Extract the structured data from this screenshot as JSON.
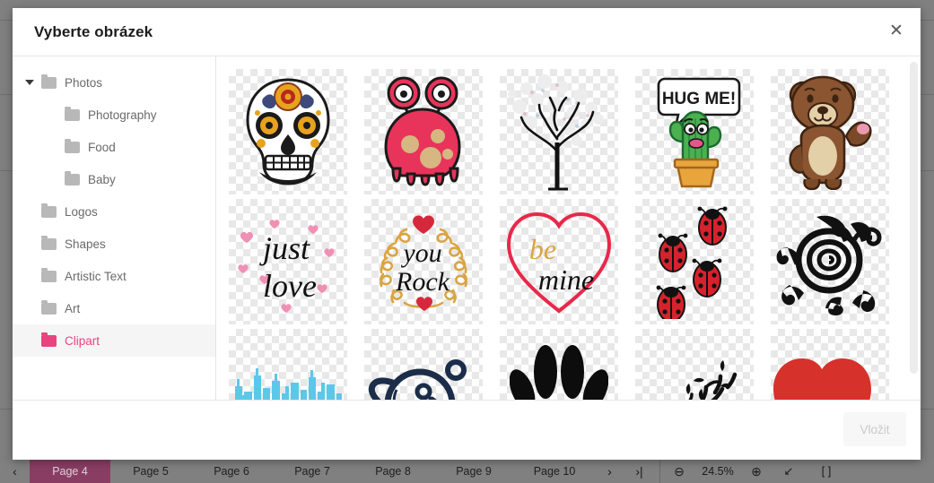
{
  "app": {
    "toolbar": {
      "undo_icon": "undo-arrow-icon",
      "redo_icon": "redo-arrow-icon"
    },
    "status_bar": {
      "prev_page_label": "‹",
      "next_page_label": "›",
      "last_page_label": "›|",
      "pages": [
        {
          "label": "Page 4",
          "active": true
        },
        {
          "label": "Page 5",
          "active": false
        },
        {
          "label": "Page 6",
          "active": false
        },
        {
          "label": "Page 7",
          "active": false
        },
        {
          "label": "Page 8",
          "active": false
        },
        {
          "label": "Page 9",
          "active": false
        },
        {
          "label": "Page 10",
          "active": false
        }
      ],
      "zoom_out_label": "⊖",
      "zoom_level": "24.5%",
      "zoom_in_label": "⊕",
      "fit_page_label": "↙",
      "fit_width_label": "[ ]"
    }
  },
  "dialog": {
    "title": "Vyberte obrázek",
    "close_label": "✕",
    "insert_label": "Vložit",
    "insert_disabled": true,
    "accent_color": "#e8447f",
    "sidebar": {
      "items": [
        {
          "label": "Photos",
          "indent": 1,
          "twisty": "open",
          "selected": false
        },
        {
          "label": "Photography",
          "indent": 2,
          "twisty": "blank",
          "selected": false
        },
        {
          "label": "Food",
          "indent": 2,
          "twisty": "blank",
          "selected": false
        },
        {
          "label": "Baby",
          "indent": 2,
          "twisty": "blank",
          "selected": false
        },
        {
          "label": "Logos",
          "indent": 1,
          "twisty": "blank",
          "selected": false
        },
        {
          "label": "Shapes",
          "indent": 1,
          "twisty": "blank",
          "selected": false
        },
        {
          "label": "Artistic Text",
          "indent": 1,
          "twisty": "blank",
          "selected": false
        },
        {
          "label": "Art",
          "indent": 1,
          "twisty": "blank",
          "selected": false
        },
        {
          "label": "Clipart",
          "indent": 1,
          "twisty": "blank",
          "selected": true
        }
      ]
    },
    "thumbnails": [
      {
        "name": "sugar-skull-clipart",
        "alt": "Decorated sugar skull with orange rose"
      },
      {
        "name": "red-monster-clipart",
        "alt": "Pink red cartoon monster with stalk eyes"
      },
      {
        "name": "blossom-tree-clipart",
        "alt": "Black tree with white blossoms"
      },
      {
        "name": "hug-me-cactus-clipart",
        "alt": "Cactus with HUG ME! speech bubble",
        "caption": "HUG ME!"
      },
      {
        "name": "waving-bear-clipart",
        "alt": "Brown teddy bear waving"
      },
      {
        "name": "just-love-lettering",
        "alt": "Just love hand lettering with hearts",
        "caption": "just love"
      },
      {
        "name": "you-rock-lettering",
        "alt": "You rock hand lettering in wreath",
        "caption": "you Rock"
      },
      {
        "name": "be-mine-lettering",
        "alt": "Be mine lettering inside red heart",
        "caption": "be mine"
      },
      {
        "name": "ladybugs-clipart",
        "alt": "Four red ladybugs in a diagonal line"
      },
      {
        "name": "tribal-turtle-clipart",
        "alt": "Black tribal spiral sea turtle"
      },
      {
        "name": "city-skyline-clipart",
        "alt": "Light blue city skyline silhouette"
      },
      {
        "name": "planet-saturn-clipart",
        "alt": "Line drawn planet with ring"
      },
      {
        "name": "paw-print-clipart",
        "alt": "Black animal paw print"
      },
      {
        "name": "cat-on-branch-clipart",
        "alt": "Cat silhouette on bare tree branch"
      },
      {
        "name": "red-hearts-clipart",
        "alt": "Large and small red hearts"
      }
    ]
  }
}
